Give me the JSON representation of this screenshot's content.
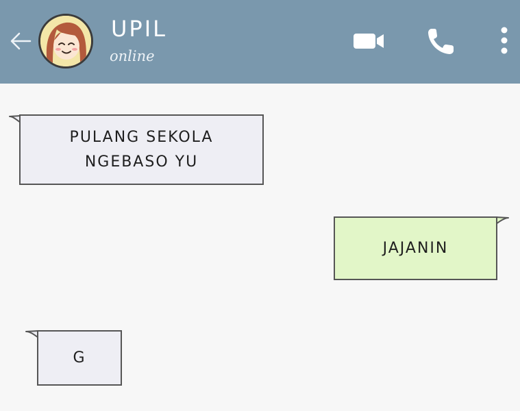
{
  "colors": {
    "header_bg": "#7a98ad",
    "chat_bg": "#f7f7f7",
    "incoming_bubble": "#eeeef4",
    "outgoing_bubble": "#e2f6c8"
  },
  "header": {
    "back_icon": "arrow-left-icon",
    "contact_name": "UPIL",
    "status": "online",
    "icons": [
      "video-call-icon",
      "phone-icon",
      "more-vertical-icon"
    ]
  },
  "messages": [
    {
      "direction": "incoming",
      "lines": [
        "PULANG SEKOLA",
        "NGEBASO YU"
      ]
    },
    {
      "direction": "outgoing",
      "lines": [
        "JAJANIN"
      ]
    },
    {
      "direction": "incoming",
      "lines": [
        "G"
      ]
    }
  ]
}
